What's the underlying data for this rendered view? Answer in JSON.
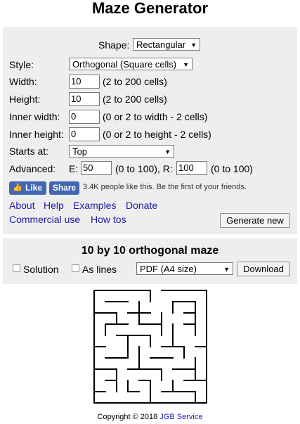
{
  "title": "Maze Generator",
  "form": {
    "shape_label": "Shape:",
    "shape_value": "Rectangular",
    "style_label": "Style:",
    "style_value": "Orthogonal (Square cells)",
    "width_label": "Width:",
    "width_value": "10",
    "width_hint": "(2 to 200 cells)",
    "height_label": "Height:",
    "height_value": "10",
    "height_hint": "(2 to 200 cells)",
    "inner_width_label": "Inner width:",
    "inner_width_value": "0",
    "inner_width_hint": "(0 or 2 to width - 2 cells)",
    "inner_height_label": "Inner height:",
    "inner_height_value": "0",
    "inner_height_hint": "(0 or 2 to height - 2 cells)",
    "starts_label": "Starts at:",
    "starts_value": "Top",
    "advanced_label": "Advanced:",
    "e_label": "E:",
    "e_value": "50",
    "e_hint": "(0 to 100), R:",
    "r_value": "100",
    "r_hint": "(0 to 100)"
  },
  "social": {
    "like_label": "Like",
    "share_label": "Share",
    "text": "3.4K people like this. Be the first of your friends."
  },
  "links": {
    "about": "About",
    "help": "Help",
    "examples": "Examples",
    "donate": "Donate",
    "commercial": "Commercial use",
    "howtos": "How tos"
  },
  "generate_label": "Generate new",
  "result": {
    "heading": "10 by 10 orthogonal maze",
    "solution_label": "Solution",
    "as_lines_label": "As lines",
    "format_value": "PDF (A4 size)",
    "download_label": "Download"
  },
  "footer": {
    "text": "Copyright © 2018",
    "link": "JGB Service"
  },
  "colors": {
    "link": "#1a1aa6",
    "facebook": "#4267b2",
    "panel": "#eeeeee"
  }
}
